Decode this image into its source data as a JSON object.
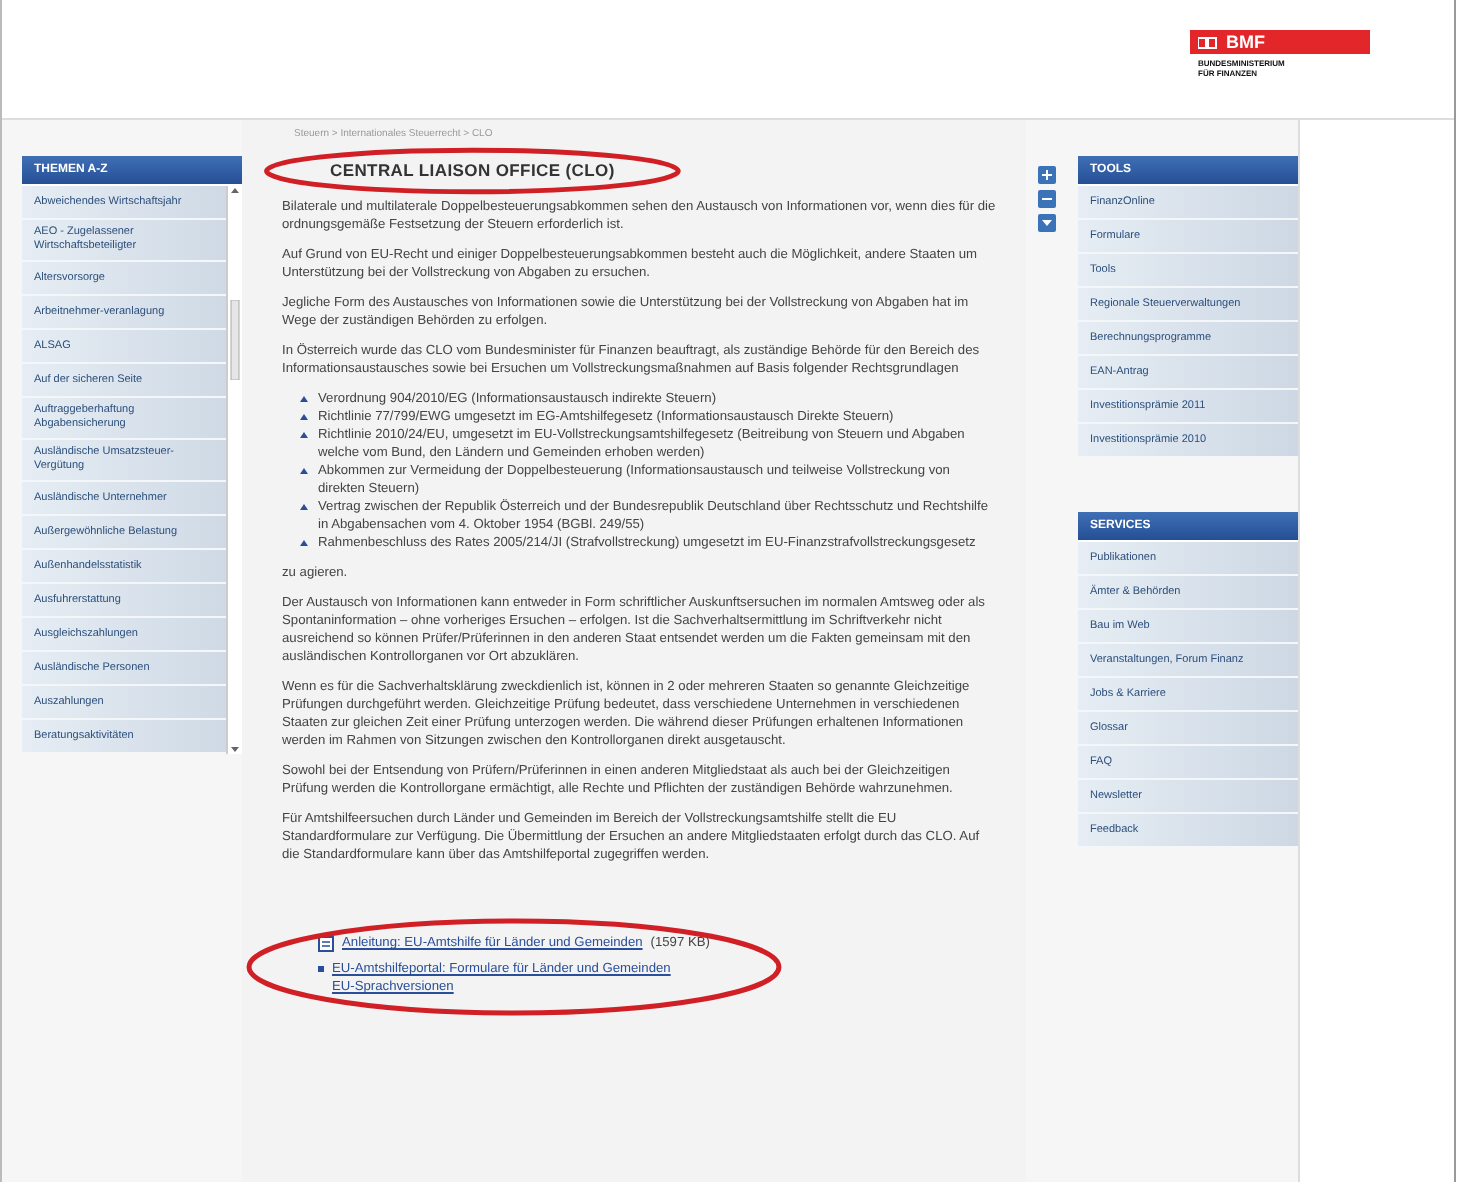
{
  "header": {
    "logo": "BMF",
    "ministry": "BUNDESMINISTERIUM FÜR FINANZEN"
  },
  "themen": {
    "title": "THEMEN A-Z",
    "items": [
      {
        "label": "Abweichendes Wirtschaftsjahr"
      },
      {
        "label": "AEO - Zugelassener Wirtschaftsbeteiligter"
      },
      {
        "label": "Altersvorsorge"
      },
      {
        "label": "Arbeitnehmer-veranlagung"
      },
      {
        "label": "ALSAG"
      },
      {
        "label": "Auf der sicheren Seite"
      },
      {
        "label": "Auftraggeberhaftung Abgabensicherung"
      },
      {
        "label": "Ausländische Umsatzsteuer-Vergütung"
      },
      {
        "label": "Ausländische Unternehmer"
      },
      {
        "label": "Außergewöhnliche Belastung"
      },
      {
        "label": "Außenhandelsstatistik"
      },
      {
        "label": "Ausfuhrerstattung"
      },
      {
        "label": "Ausgleichszahlungen"
      },
      {
        "label": "Ausländische Personen"
      },
      {
        "label": "Auszahlungen"
      },
      {
        "label": "Beratungsaktivitäten"
      }
    ]
  },
  "article": {
    "breadcrumb": "Steuern > Internationales Steuerrecht > CLO",
    "title": "CENTRAL LIAISON OFFICE (CLO)",
    "circled": true,
    "blocks": [
      {
        "kind": "paragraph",
        "text": "Bilaterale und multilaterale Doppelbesteuerungsabkommen sehen den Austausch von Informationen vor, wenn dies für die ordnungsgemäße Festsetzung der Steuern erforderlich ist."
      },
      {
        "kind": "paragraph",
        "text": "Auf Grund von EU-Recht und einiger Doppelbesteuerungsabkommen besteht auch die Möglichkeit, andere Staaten um Unterstützung bei der Vollstreckung von Abgaben zu ersuchen."
      },
      {
        "kind": "paragraph",
        "text": "Jegliche Form des Austausches von Informationen sowie die Unterstützung bei der Vollstreckung von Abgaben hat im Wege der zuständigen Behörden zu erfolgen."
      },
      {
        "kind": "paragraph",
        "text": "In Österreich wurde das CLO vom Bundesminister für Finanzen beauftragt, als zuständige Behörde für den Bereich des Informationsaustausches sowie bei Ersuchen um Vollstreckungsmaßnahmen auf Basis folgender Rechtsgrundlagen"
      },
      {
        "kind": "list",
        "items": [
          "Verordnung 904/2010/EG (Informationsaustausch indirekte Steuern)",
          "Richtlinie 77/799/EWG umgesetzt im EG-Amtshilfegesetz (Informationsaustausch Direkte Steuern)",
          "Richtlinie 2010/24/EU, umgesetzt im EU-Vollstreckungsamtshilfegesetz (Beitreibung von Steuern und Abgaben welche vom Bund, den Ländern und Gemeinden erhoben werden)",
          "Abkommen zur Vermeidung der Doppelbesteuerung (Informationsaustausch und teilweise Vollstreckung von direkten Steuern)",
          "Vertrag zwischen der Republik Österreich und der Bundesrepublik Deutschland über Rechtsschutz und Rechtshilfe in Abgabensachen vom 4. Oktober 1954 (BGBl. 249/55)",
          "Rahmenbeschluss des Rates 2005/214/JI (Strafvollstreckung) umgesetzt im EU-Finanzstrafvollstreckungsgesetz"
        ]
      },
      {
        "kind": "paragraph",
        "text": "zu agieren."
      },
      {
        "kind": "paragraph",
        "text": "Der Austausch von Informationen kann entweder in Form schriftlicher Auskunftsersuchen im normalen Amtsweg oder als Spontaninformation – ohne vorheriges Ersuchen – erfolgen. Ist die Sachverhaltsermittlung im Schriftverkehr nicht ausreichend so können Prüfer/Prüferinnen in den anderen Staat entsendet werden um die Fakten gemeinsam mit den ausländischen Kontrollorganen vor Ort abzuklären."
      },
      {
        "kind": "paragraph",
        "text": "Wenn es für die Sachverhaltsklärung zweckdienlich ist, können in 2 oder mehreren Staaten so genannte Gleichzeitige Prüfungen durchgeführt werden. Gleichzeitige Prüfung bedeutet, dass verschiedene Unternehmen in verschiedenen Staaten zur gleichen Zeit einer Prüfung unterzogen werden. Die während dieser Prüfungen erhaltenen Informationen werden im Rahmen von Sitzungen zwischen den Kontrollorganen direkt ausgetauscht."
      },
      {
        "kind": "paragraph",
        "text": "Sowohl bei der Entsendung von Prüfern/Prüferinnen in einen anderen Mitgliedstaat als auch bei der Gleichzeitigen Prüfung werden die Kontrollorgane ermächtigt, alle Rechte und Pflichten der zuständigen Behörde wahrzunehmen."
      },
      {
        "kind": "paragraph",
        "text": "Für Amtshilfeersuchen durch Länder und Gemeinden im Bereich der Vollstreckungsamtshilfe stellt die EU Standardformulare zur Verfügung. Die Übermittlung der Ersuchen an andere Mitgliedstaaten erfolgt durch das CLO. Auf die Standardformulare kann über das Amtshilfeportal zugegriffen werden."
      }
    ],
    "links": {
      "circled": true,
      "items": [
        {
          "kind": "file",
          "text": "Anleitung: EU-Amtshilfe für Länder und Gemeinden",
          "size": "(1597 KB)"
        },
        {
          "kind": "link",
          "text": "EU-Amtshilfeportal: Formulare für Länder und Gemeinden",
          "extra": "EU-Sprachversionen"
        }
      ]
    }
  },
  "tools": {
    "title": "TOOLS",
    "items": [
      {
        "label": "FinanzOnline"
      },
      {
        "label": "Formulare"
      },
      {
        "label": "Tools"
      },
      {
        "label": "Regionale Steuerverwaltungen"
      },
      {
        "label": "Berechnungsprogramme"
      },
      {
        "label": "EAN-Antrag"
      },
      {
        "label": "Investitionsprämie 2011"
      },
      {
        "label": "Investitionsprämie 2010"
      }
    ]
  },
  "services": {
    "title": "SERVICES",
    "items": [
      {
        "label": "Publikationen"
      },
      {
        "label": "Ämter & Behörden"
      },
      {
        "label": "Bau im Web"
      },
      {
        "label": "Veranstaltungen, Forum Finanz"
      },
      {
        "label": "Jobs & Karriere"
      },
      {
        "label": "Glossar"
      },
      {
        "label": "FAQ"
      },
      {
        "label": "Newsletter"
      },
      {
        "label": "Feedback"
      }
    ]
  }
}
